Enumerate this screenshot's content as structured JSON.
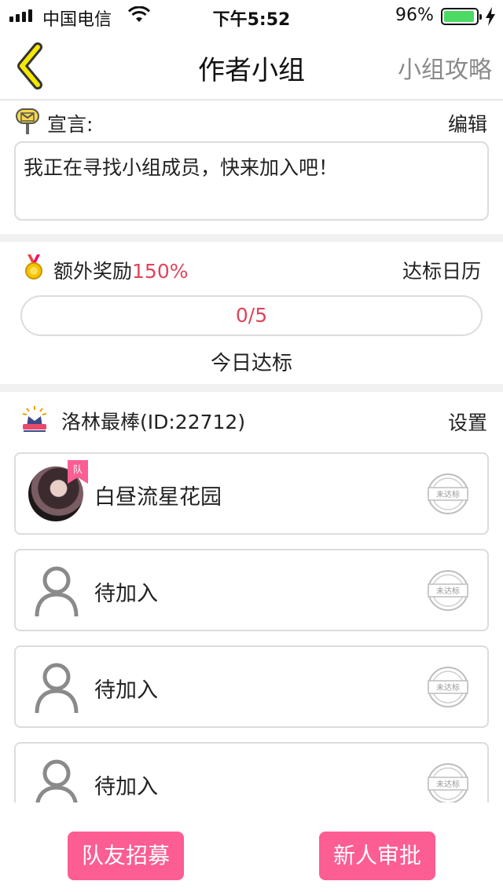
{
  "status_bar": {
    "carrier": "中国电信",
    "time": "下午5:52",
    "battery_percent": "96%",
    "battery_level": 0.96,
    "signal_icon": "signal-bars-icon",
    "wifi_icon": "wifi-icon",
    "charging_icon": "charging-bolt-icon"
  },
  "nav": {
    "back_icon": "chevron-left-icon",
    "title": "作者小组",
    "right_link": "小组攻略"
  },
  "declaration": {
    "icon": "mailbox-icon",
    "label": "宣言:",
    "edit_label": "编辑",
    "text": "我正在寻找小组成员，快来加入吧！"
  },
  "reward": {
    "icon": "medal-icon",
    "label": "额外奖励",
    "percent": "150%",
    "calendar_link": "达标日历",
    "progress_text": "0/5",
    "progress_caption": "今日达标"
  },
  "group": {
    "icon": "crown-badge-icon",
    "name": "洛林最棒(ID:22712)",
    "settings_label": "设置"
  },
  "members": [
    {
      "name": "白昼流星花园",
      "badge": "队",
      "avatar": "user-avatar",
      "stamp": "未达标"
    },
    {
      "name": "待加入",
      "avatar": "person-placeholder-icon",
      "stamp": "未达标"
    },
    {
      "name": "待加入",
      "avatar": "person-placeholder-icon",
      "stamp": "未达标"
    },
    {
      "name": "待加入",
      "avatar": "person-placeholder-icon",
      "stamp": "未达标"
    }
  ],
  "actions": {
    "recruit": "队友招募",
    "approve": "新人审批"
  },
  "colors": {
    "accent_pink": "#fc5d92",
    "highlight_red": "#e0445a",
    "back_arrow_yellow": "#f5e800",
    "battery_green": "#4cd964"
  }
}
